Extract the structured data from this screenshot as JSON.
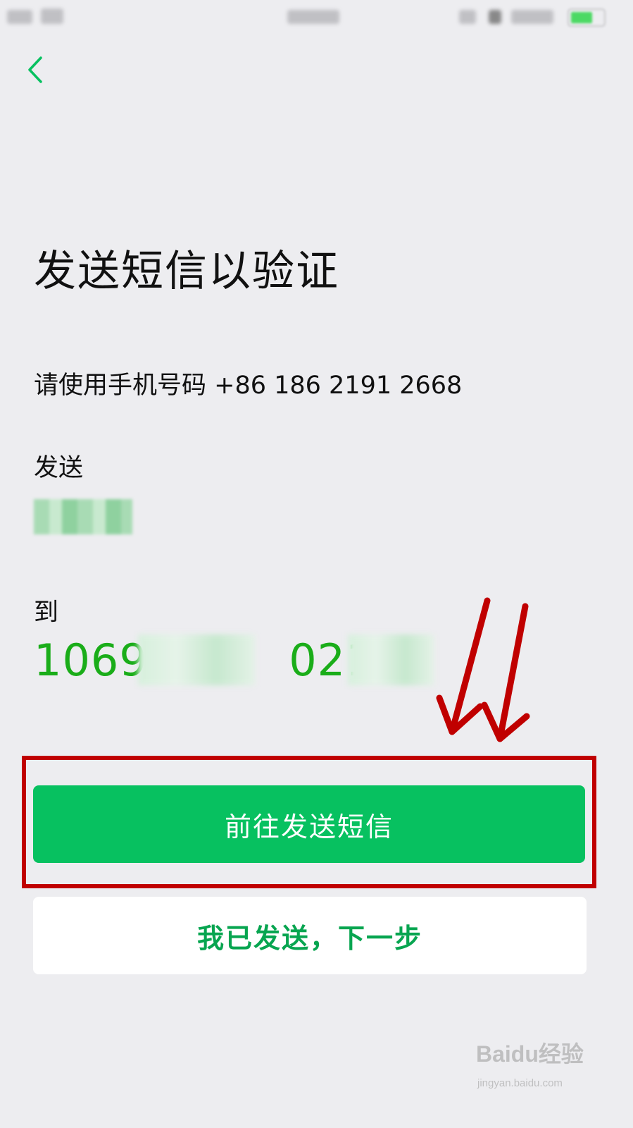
{
  "header": {
    "back_icon": "chevron-left-icon"
  },
  "main": {
    "title": "发送短信以验证",
    "instruction": "请使用手机号码 +86 186 2191 2668",
    "send_label": "发送",
    "to_label": "到",
    "sms_number_visible_start": "10690",
    "sms_number_visible_mid": "0212"
  },
  "actions": {
    "primary_label": "前往发送短信",
    "secondary_label": "我已发送，下一步"
  },
  "watermark": {
    "logo": "Baidu经验",
    "url": "jingyan.baidu.com"
  },
  "colors": {
    "accent": "#07c160",
    "number_green": "#1aad19",
    "highlight_red": "#c00000",
    "background": "#ededf0"
  }
}
